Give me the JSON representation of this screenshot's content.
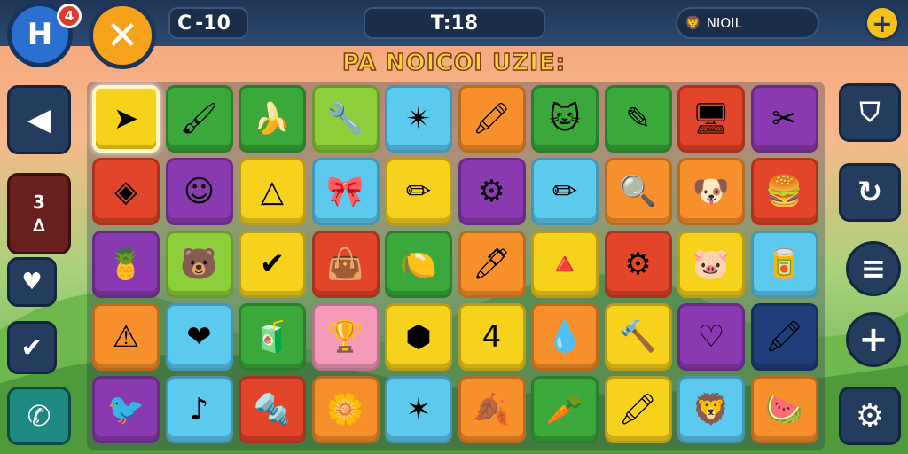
{
  "header": {
    "home_glyph": "H",
    "notification_count": "4",
    "close_glyph": "✕",
    "score_icon": "C",
    "score_value": "-10",
    "timer_text": "T:18",
    "player_emoji": "🦁",
    "player_name": "NIOIL",
    "add_glyph": "+"
  },
  "title": "PA NOICOI UZIE:",
  "left_panel": {
    "back_glyph": "◀",
    "level_top": "3",
    "level_bottom": "∆",
    "heart_glyph": "♥",
    "check_glyph": "✔",
    "phone_glyph": "✆"
  },
  "right_panel": {
    "cup_glyph": "⛉",
    "refresh_glyph": "↻",
    "menu_glyph": "≡",
    "plus_glyph": "+",
    "settings_glyph": "⚙"
  },
  "colors": {
    "yellow": "#f7d21c",
    "green": "#3aa83a",
    "lime": "#8ccf3a",
    "cyan": "#5cc9ef",
    "orange": "#f7902a",
    "red": "#e2452a",
    "purple": "#8a3ab0",
    "pink": "#f59ab8",
    "navy": "#1f3f7a"
  },
  "tiles": [
    [
      {
        "color": "yellow",
        "glyph": "➤",
        "name": "arrow-icon",
        "selected": true
      },
      {
        "color": "green",
        "glyph": "🖌",
        "name": "paint-brush-icon"
      },
      {
        "color": "green",
        "glyph": "🍌",
        "name": "banana-icon"
      },
      {
        "color": "lime",
        "glyph": "🔧",
        "name": "wrench-icon"
      },
      {
        "color": "cyan",
        "glyph": "✴",
        "name": "star-icon"
      },
      {
        "color": "orange",
        "glyph": "🖍",
        "name": "crayon-icon"
      },
      {
        "color": "green",
        "glyph": "🐱",
        "name": "cat-icon"
      },
      {
        "color": "green",
        "glyph": "✎",
        "name": "pen-icon"
      },
      {
        "color": "red",
        "glyph": "🖥",
        "name": "monitor-icon"
      },
      {
        "color": "purple",
        "glyph": "✂",
        "name": "scissors-icon"
      }
    ],
    [
      {
        "color": "red",
        "glyph": "◈",
        "name": "sign-icon"
      },
      {
        "color": "purple",
        "glyph": "☺",
        "name": "ghost-icon"
      },
      {
        "color": "yellow",
        "glyph": "△",
        "name": "triangle-icon"
      },
      {
        "color": "cyan",
        "glyph": "🎀",
        "name": "ribbon-icon"
      },
      {
        "color": "yellow",
        "glyph": "✏",
        "name": "pencil-icon"
      },
      {
        "color": "purple",
        "glyph": "⚙",
        "name": "gear-icon"
      },
      {
        "color": "cyan",
        "glyph": "✏",
        "name": "pencil-icon"
      },
      {
        "color": "orange",
        "glyph": "🔍",
        "name": "magnifier-icon"
      },
      {
        "color": "orange",
        "glyph": "🐶",
        "name": "dog-icon"
      },
      {
        "color": "red",
        "glyph": "🍔",
        "name": "burger-icon"
      }
    ],
    [
      {
        "color": "purple",
        "glyph": "🍍",
        "name": "pineapple-icon"
      },
      {
        "color": "lime",
        "glyph": "🐻",
        "name": "bear-icon"
      },
      {
        "color": "yellow",
        "glyph": "✔",
        "name": "checkmark-icon"
      },
      {
        "color": "red",
        "glyph": "👜",
        "name": "bag-icon"
      },
      {
        "color": "green",
        "glyph": "🍋",
        "name": "lemon-icon"
      },
      {
        "color": "orange",
        "glyph": "🖊",
        "name": "marker-icon"
      },
      {
        "color": "yellow",
        "glyph": "🔺",
        "name": "crystal-icon"
      },
      {
        "color": "red",
        "glyph": "⚙",
        "name": "cog-icon"
      },
      {
        "color": "yellow",
        "glyph": "🐷",
        "name": "pig-icon"
      },
      {
        "color": "cyan",
        "glyph": "🥫",
        "name": "jar-icon"
      }
    ],
    [
      {
        "color": "orange",
        "glyph": "⚠",
        "name": "warning-icon"
      },
      {
        "color": "cyan",
        "glyph": "❤",
        "name": "heart-icon"
      },
      {
        "color": "green",
        "glyph": "🧃",
        "name": "juice-box-icon"
      },
      {
        "color": "pink",
        "glyph": "🏆",
        "name": "trophy-icon"
      },
      {
        "color": "yellow",
        "glyph": "⬢",
        "name": "hexagon-icon"
      },
      {
        "color": "yellow",
        "glyph": "4",
        "name": "number-four-icon"
      },
      {
        "color": "orange",
        "glyph": "💧",
        "name": "drop-icon"
      },
      {
        "color": "yellow",
        "glyph": "🔨",
        "name": "hammer-icon"
      },
      {
        "color": "purple",
        "glyph": "♡",
        "name": "heart-outline-icon"
      },
      {
        "color": "navy",
        "glyph": "🖍",
        "name": "crayon-icon"
      }
    ],
    [
      {
        "color": "purple",
        "glyph": "🐦",
        "name": "bird-icon"
      },
      {
        "color": "cyan",
        "glyph": "♪",
        "name": "music-note-icon"
      },
      {
        "color": "red",
        "glyph": "🔩",
        "name": "screw-icon"
      },
      {
        "color": "orange",
        "glyph": "🌼",
        "name": "flower-icon"
      },
      {
        "color": "cyan",
        "glyph": "✶",
        "name": "starfish-icon"
      },
      {
        "color": "orange",
        "glyph": "🍂",
        "name": "leaf-icon"
      },
      {
        "color": "green",
        "glyph": "🥕",
        "name": "carrot-icon"
      },
      {
        "color": "yellow",
        "glyph": "🖍",
        "name": "crayon-icon"
      },
      {
        "color": "cyan",
        "glyph": "🦁",
        "name": "lion-icon"
      },
      {
        "color": "orange",
        "glyph": "🍉",
        "name": "melon-icon"
      }
    ]
  ]
}
